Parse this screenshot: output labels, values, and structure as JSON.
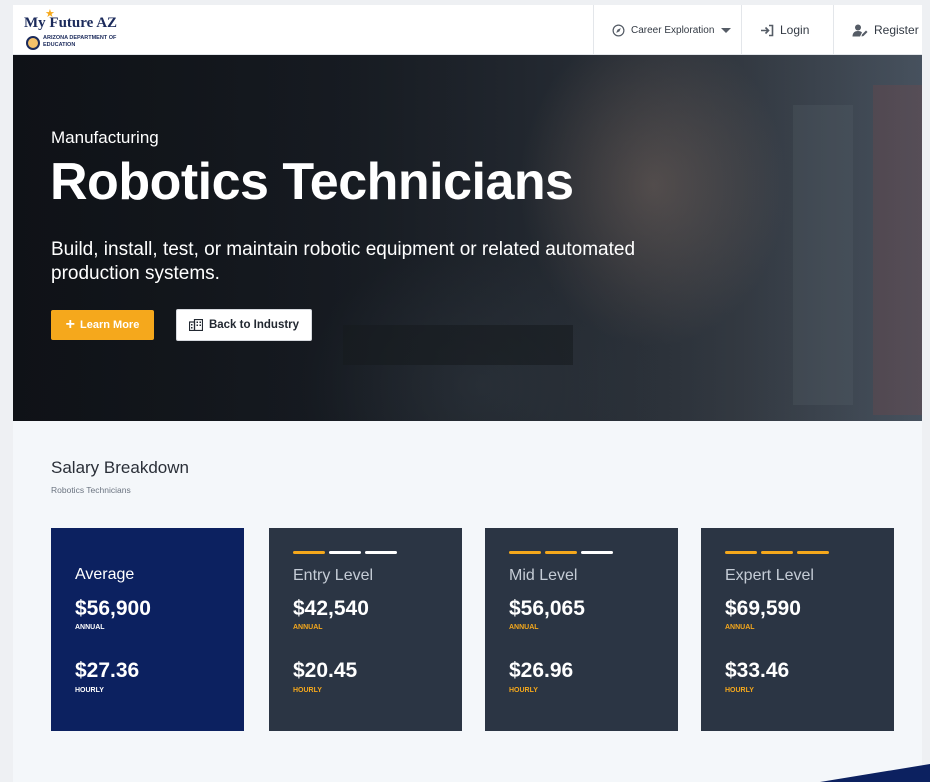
{
  "header": {
    "logo_title": "My Future AZ",
    "logo_subtitle": "ARIZONA DEPARTMENT OF EDUCATION",
    "nav": {
      "career_exploration": "Career Exploration",
      "login": "Login",
      "register": "Register"
    }
  },
  "hero": {
    "eyebrow": "Manufacturing",
    "title": "Robotics Technicians",
    "description": "Build, install, test, or maintain robotic equipment or related automated production systems.",
    "learn_more": "Learn More",
    "back_to_industry": "Back to Industry"
  },
  "salary": {
    "title": "Salary Breakdown",
    "subtitle": "Robotics Technicians",
    "annual_label": "ANNUAL",
    "hourly_label": "HOURLY",
    "cards": [
      {
        "level": "Average",
        "annual": "$56,900",
        "hourly": "$27.36",
        "filled_bars": 0
      },
      {
        "level": "Entry Level",
        "annual": "$42,540",
        "hourly": "$20.45",
        "filled_bars": 1
      },
      {
        "level": "Mid Level",
        "annual": "$56,065",
        "hourly": "$26.96",
        "filled_bars": 2
      },
      {
        "level": "Expert Level",
        "annual": "$69,590",
        "hourly": "$33.46",
        "filled_bars": 3
      }
    ]
  },
  "colors": {
    "accent": "#f5a81c",
    "navy": "#0c2160",
    "card": "#2b3544"
  },
  "icons": {
    "career": "compass-icon",
    "login": "sign-in-icon",
    "register": "user-edit-icon",
    "learn_more": "plus-icon",
    "back": "building-icon"
  }
}
